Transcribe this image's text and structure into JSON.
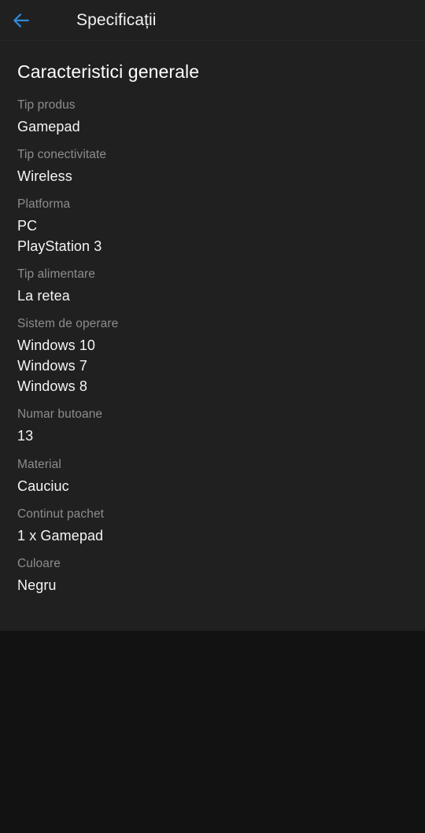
{
  "appbar": {
    "back_icon": "arrow-left-icon",
    "back_icon_color": "#2f8ad8",
    "title": "Specificații"
  },
  "colors": {
    "page_background": "#121212",
    "card_background": "#202020",
    "label_text": "#8d8d8d",
    "value_text": "#f4f4f4",
    "accent": "#2f8ad8"
  },
  "main": {
    "section_title": "Caracteristici generale",
    "specs": [
      {
        "label": "Tip produs",
        "values": [
          "Gamepad"
        ]
      },
      {
        "label": "Tip conectivitate",
        "values": [
          "Wireless"
        ]
      },
      {
        "label": "Platforma",
        "values": [
          "PC",
          "PlayStation 3"
        ]
      },
      {
        "label": "Tip alimentare",
        "values": [
          "La retea"
        ]
      },
      {
        "label": "Sistem de operare",
        "values": [
          "Windows 10",
          "Windows 7",
          "Windows 8"
        ]
      },
      {
        "label": "Numar butoane",
        "values": [
          "13"
        ]
      },
      {
        "label": "Material",
        "values": [
          "Cauciuc"
        ]
      },
      {
        "label": "Continut pachet",
        "values": [
          "1 x Gamepad"
        ]
      },
      {
        "label": "Culoare",
        "values": [
          "Negru"
        ]
      }
    ]
  }
}
